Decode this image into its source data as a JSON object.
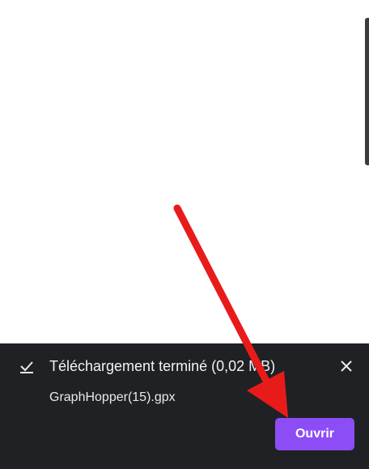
{
  "download": {
    "title": "Téléchargement terminé (0,02 MB)",
    "filename": "GraphHopper(15).gpx",
    "open_label": "Ouvrir",
    "status_icon": "check-icon",
    "close_icon": "close-icon"
  },
  "colors": {
    "bar_background": "#202125",
    "button_accent": "#8c4df7",
    "annotation_arrow": "#e81b1b"
  }
}
